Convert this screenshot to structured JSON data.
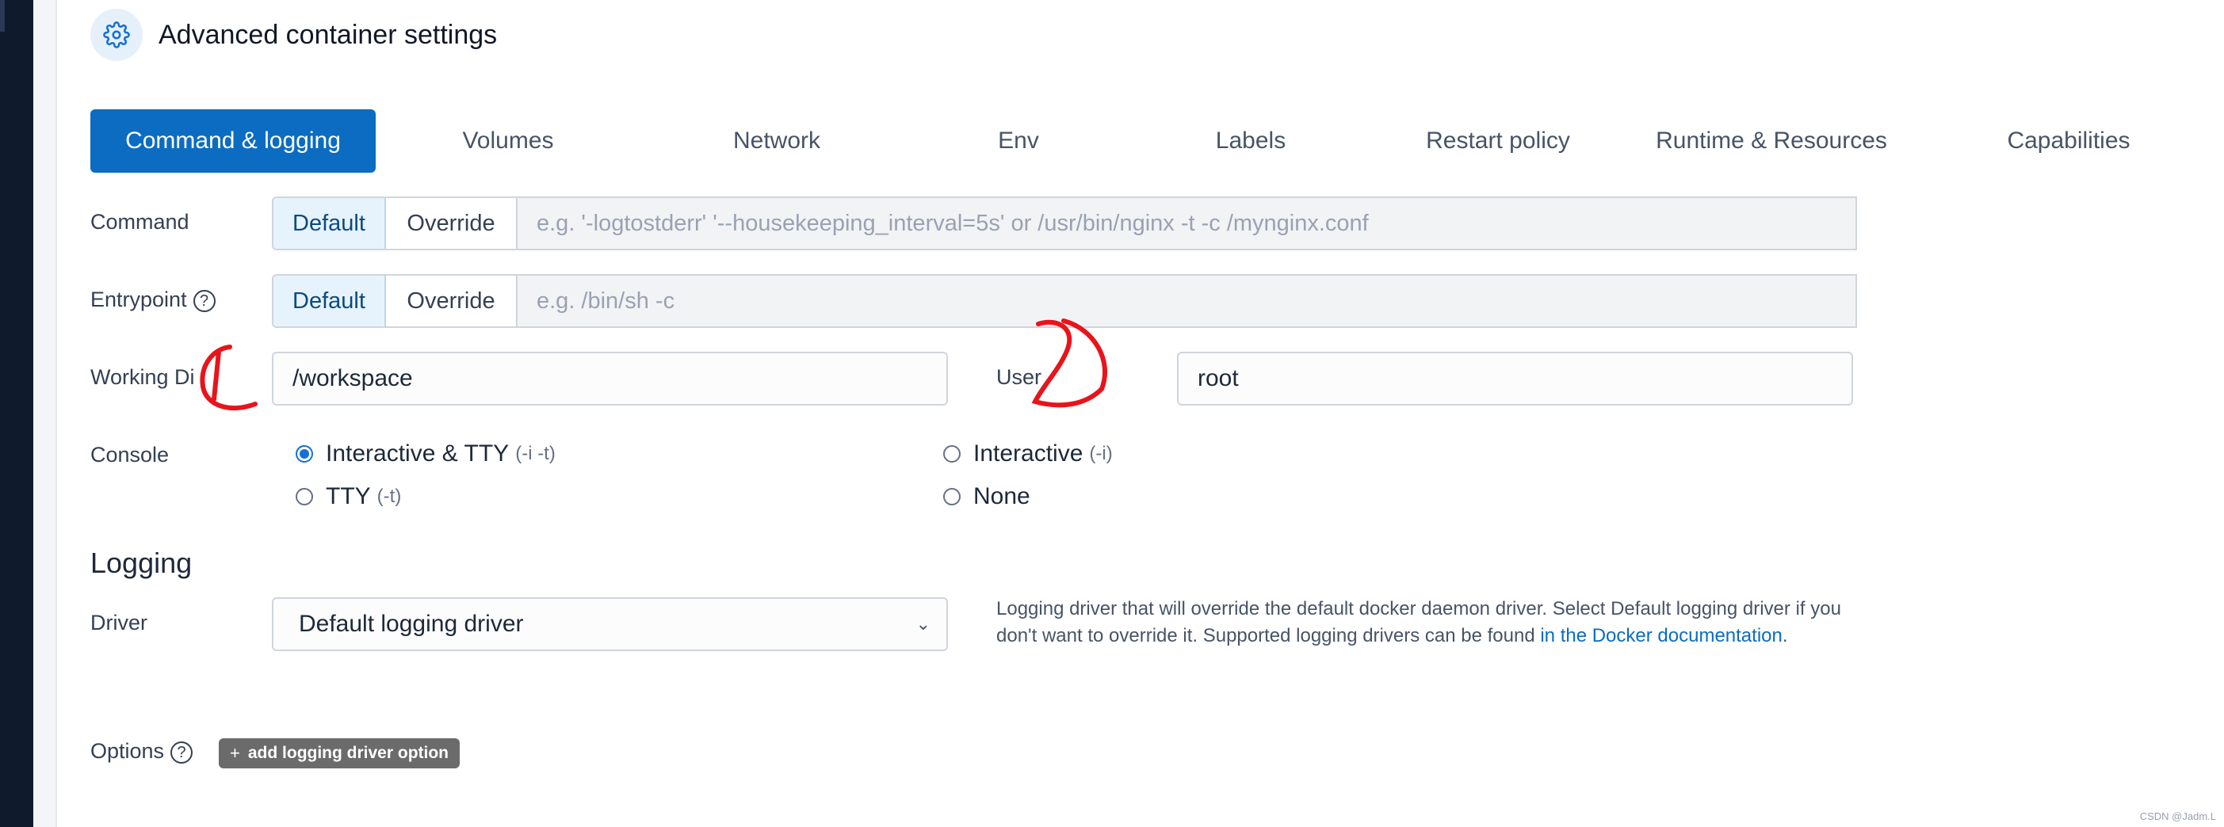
{
  "header": {
    "title": "Advanced container settings",
    "icon": "gear-icon"
  },
  "tabs": [
    {
      "label": "Command & logging",
      "active": true
    },
    {
      "label": "Volumes",
      "active": false
    },
    {
      "label": "Network",
      "active": false
    },
    {
      "label": "Env",
      "active": false
    },
    {
      "label": "Labels",
      "active": false
    },
    {
      "label": "Restart policy",
      "active": false
    },
    {
      "label": "Runtime & Resources",
      "active": false
    },
    {
      "label": "Capabilities",
      "active": false
    }
  ],
  "command": {
    "label": "Command",
    "default_label": "Default",
    "override_label": "Override",
    "placeholder": "e.g. '-logtostderr' '--housekeeping_interval=5s' or /usr/bin/nginx -t -c /mynginx.conf",
    "selected": "Default"
  },
  "entrypoint": {
    "label": "Entrypoint",
    "help_glyph": "?",
    "default_label": "Default",
    "override_label": "Override",
    "placeholder": "e.g. /bin/sh -c",
    "selected": "Default"
  },
  "working_dir": {
    "label": "Working Di",
    "value": "/workspace"
  },
  "user": {
    "label": "User",
    "value": "root"
  },
  "console": {
    "label": "Console",
    "options": [
      {
        "label": "Interactive & TTY",
        "hint": "(-i -t)",
        "checked": true
      },
      {
        "label": "Interactive",
        "hint": "(-i)",
        "checked": false
      },
      {
        "label": "TTY",
        "hint": "(-t)",
        "checked": false
      },
      {
        "label": "None",
        "hint": "",
        "checked": false
      }
    ]
  },
  "logging": {
    "section_title": "Logging",
    "driver_label": "Driver",
    "driver_value": "Default logging driver",
    "help_text_1": "Logging driver that will override the default docker daemon driver. Select Default logging driver if you don't want to override it. Supported logging drivers can be found ",
    "help_link": "in the Docker documentation",
    "help_text_2": "."
  },
  "options": {
    "label": "Options",
    "help_glyph": "?",
    "add_button": "add logging driver option",
    "add_button_glyph": "+"
  },
  "watermark": "CSDN @Jadm.L",
  "colors": {
    "accent": "#0b6cc2",
    "annotation": "#e8141b"
  }
}
